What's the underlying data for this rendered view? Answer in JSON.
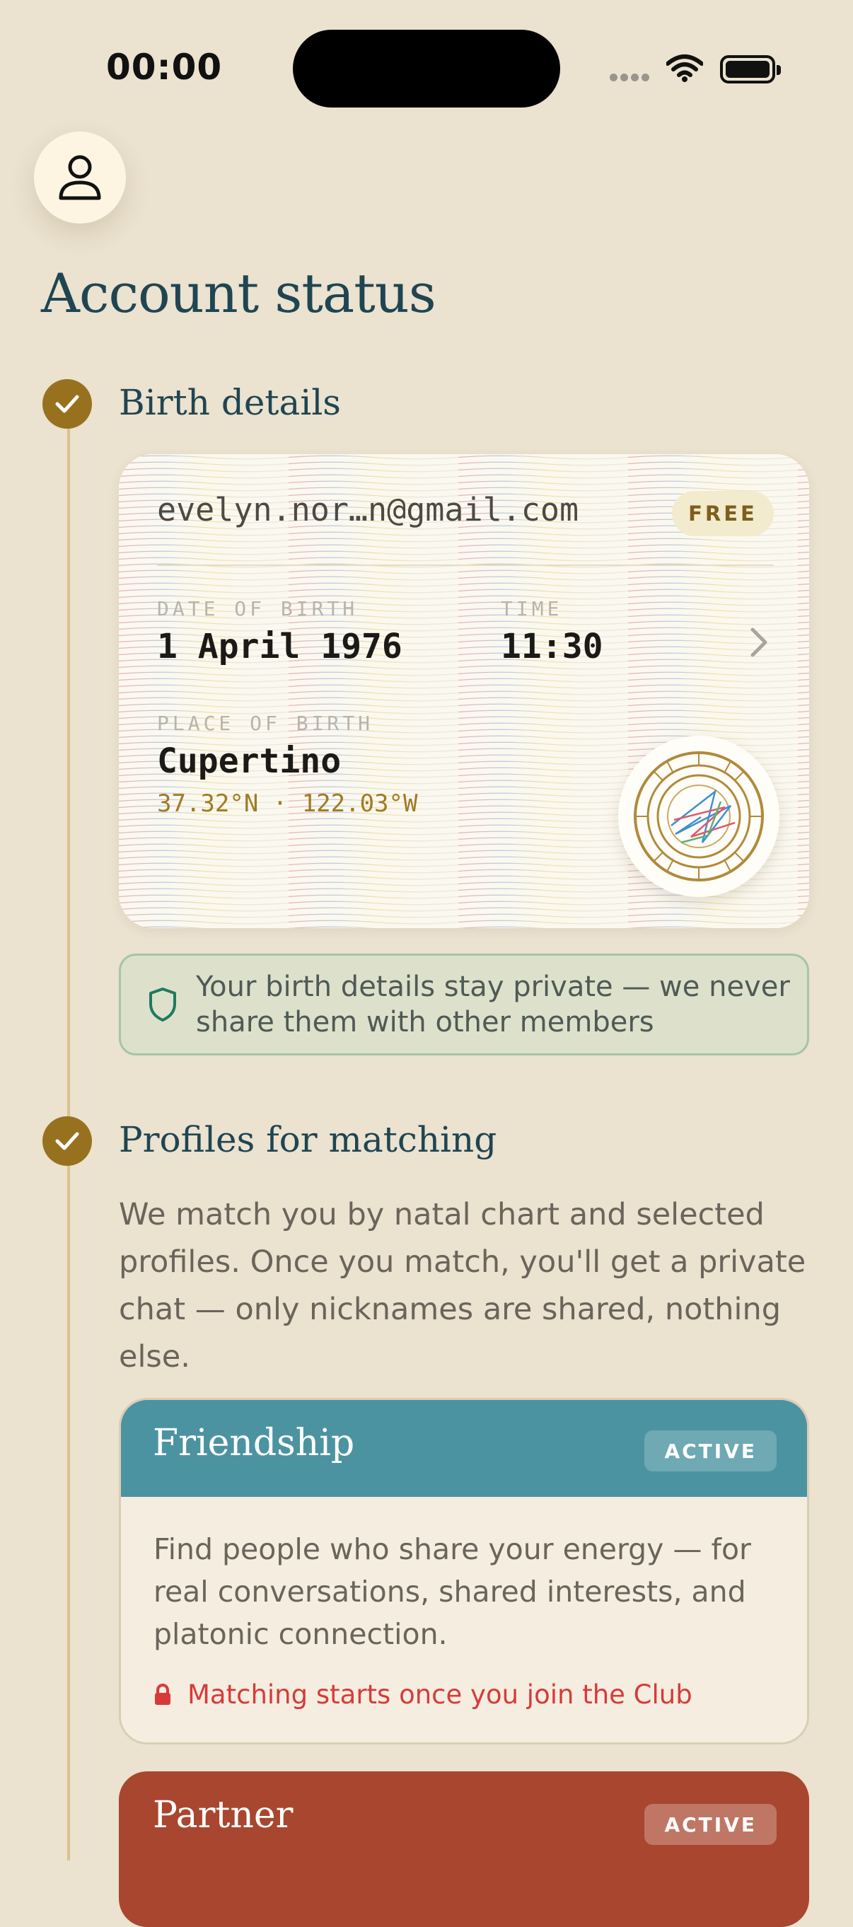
{
  "status_bar": {
    "time": "00:00"
  },
  "page_title": "Account status",
  "steps": [
    {
      "title": "Birth details"
    },
    {
      "title": "Profiles for matching"
    }
  ],
  "birth_card": {
    "email": "evelyn.nor…n@gmail.com",
    "plan_badge": "FREE",
    "dob_label": "DATE OF BIRTH",
    "dob_value": "1 April 1976",
    "time_label": "TIME",
    "time_value": "11:30",
    "place_label": "PLACE OF BIRTH",
    "place_value": "Cupertino",
    "coordinates": "37.32°N · 122.03°W"
  },
  "privacy_note": "Your birth details stay private — we never share them with other members",
  "matching_intro": "We match you by natal chart and selected profiles. Once you match, you'll get a private chat — only nicknames are shared, nothing else.",
  "profiles": [
    {
      "title": "Friendship",
      "badge": "ACTIVE",
      "description": "Find people who share your energy — for real conversations, shared interests, and platonic connection.",
      "lock_note": "Matching starts once you join the Club",
      "color": "#4c93a1"
    },
    {
      "title": "Partner",
      "badge": "ACTIVE",
      "color": "#a8462f"
    }
  ],
  "icons": [
    "user-icon",
    "check-icon",
    "chevron-right-icon",
    "natal-chart-icon",
    "shield-icon",
    "lock-icon",
    "wifi-icon",
    "battery-icon"
  ]
}
